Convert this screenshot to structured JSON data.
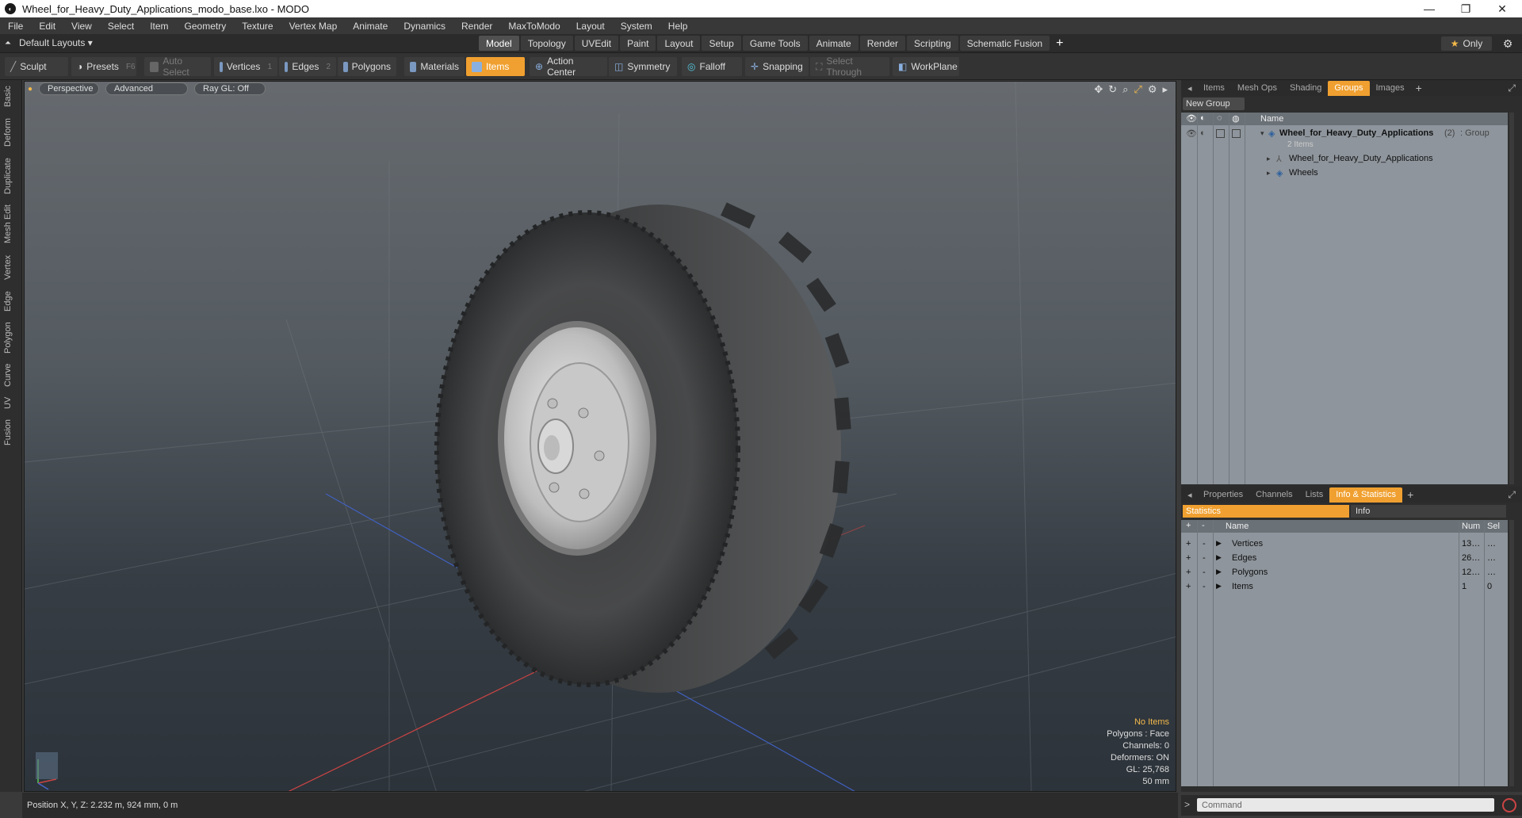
{
  "window": {
    "title": "Wheel_for_Heavy_Duty_Applications_modo_base.lxo - MODO",
    "minimize": "—",
    "maximize": "❐",
    "close": "✕"
  },
  "menu": [
    "File",
    "Edit",
    "View",
    "Select",
    "Item",
    "Geometry",
    "Texture",
    "Vertex Map",
    "Animate",
    "Dynamics",
    "Render",
    "MaxToModo",
    "Layout",
    "System",
    "Help"
  ],
  "layoutbar": {
    "layout_label": "Default Layouts ▾",
    "tabs": [
      "Model",
      "Topology",
      "UVEdit",
      "Paint",
      "Layout",
      "Setup",
      "Game Tools",
      "Animate",
      "Render",
      "Scripting",
      "Schematic Fusion"
    ],
    "active_tab": "Model",
    "add": "+",
    "only_label": "Only",
    "star": "★"
  },
  "toolbar": {
    "sculpt": "Sculpt",
    "presets": "Presets",
    "presets_key": "F6",
    "auto_select": "Auto Select",
    "vertices": "Vertices",
    "vertices_key": "1",
    "edges": "Edges",
    "edges_key": "2",
    "polygons": "Polygons",
    "materials": "Materials",
    "items": "Items",
    "action_center": "Action Center",
    "symmetry": "Symmetry",
    "falloff": "Falloff",
    "snapping": "Snapping",
    "select_through": "Select Through",
    "workplane": "WorkPlane"
  },
  "left_tabs": [
    "Basic",
    "Deform",
    "Duplicate",
    "Mesh Edit",
    "Vertex",
    "Edge",
    "Polygon",
    "Curve",
    "UV",
    "Fusion"
  ],
  "viewport": {
    "perspective": "Perspective",
    "advanced": "Advanced",
    "raygl": "Ray GL: Off",
    "info": {
      "no_items": "No Items",
      "polygons": "Polygons : Face",
      "channels": "Channels: 0",
      "deformers": "Deformers: ON",
      "gl": "GL: 25,768",
      "size": "50 mm"
    }
  },
  "status": {
    "position": "Position X, Y, Z:  2.232 m, 924 mm, 0 m"
  },
  "groups_panel": {
    "tabs": [
      "Items",
      "Mesh Ops",
      "Shading",
      "Groups",
      "Images"
    ],
    "active": "Groups",
    "new_group": "New Group",
    "col_name": "Name",
    "group_name": "Wheel_for_Heavy_Duty_Applications",
    "group_count": "(2)",
    "group_type": ": Group",
    "group_sub": "2 Items",
    "children": [
      "Wheel_for_Heavy_Duty_Applications",
      "Wheels"
    ]
  },
  "info_panel": {
    "tabs": [
      "Properties",
      "Channels",
      "Lists",
      "Info & Statistics"
    ],
    "active": "Info & Statistics",
    "sub_tabs": [
      "Statistics",
      "Info"
    ],
    "cols": {
      "name": "Name",
      "num": "Num",
      "sel": "Sel"
    },
    "rows": [
      {
        "name": "Vertices",
        "num": "13…",
        "sel": "…"
      },
      {
        "name": "Edges",
        "num": "26…",
        "sel": "…"
      },
      {
        "name": "Polygons",
        "num": "12…",
        "sel": "…"
      },
      {
        "name": "Items",
        "num": "1",
        "sel": "0"
      }
    ]
  },
  "command": {
    "placeholder": "Command",
    "prompt": ">"
  },
  "colors": {
    "accent": "#f0a030",
    "panel": "#8e959c"
  }
}
